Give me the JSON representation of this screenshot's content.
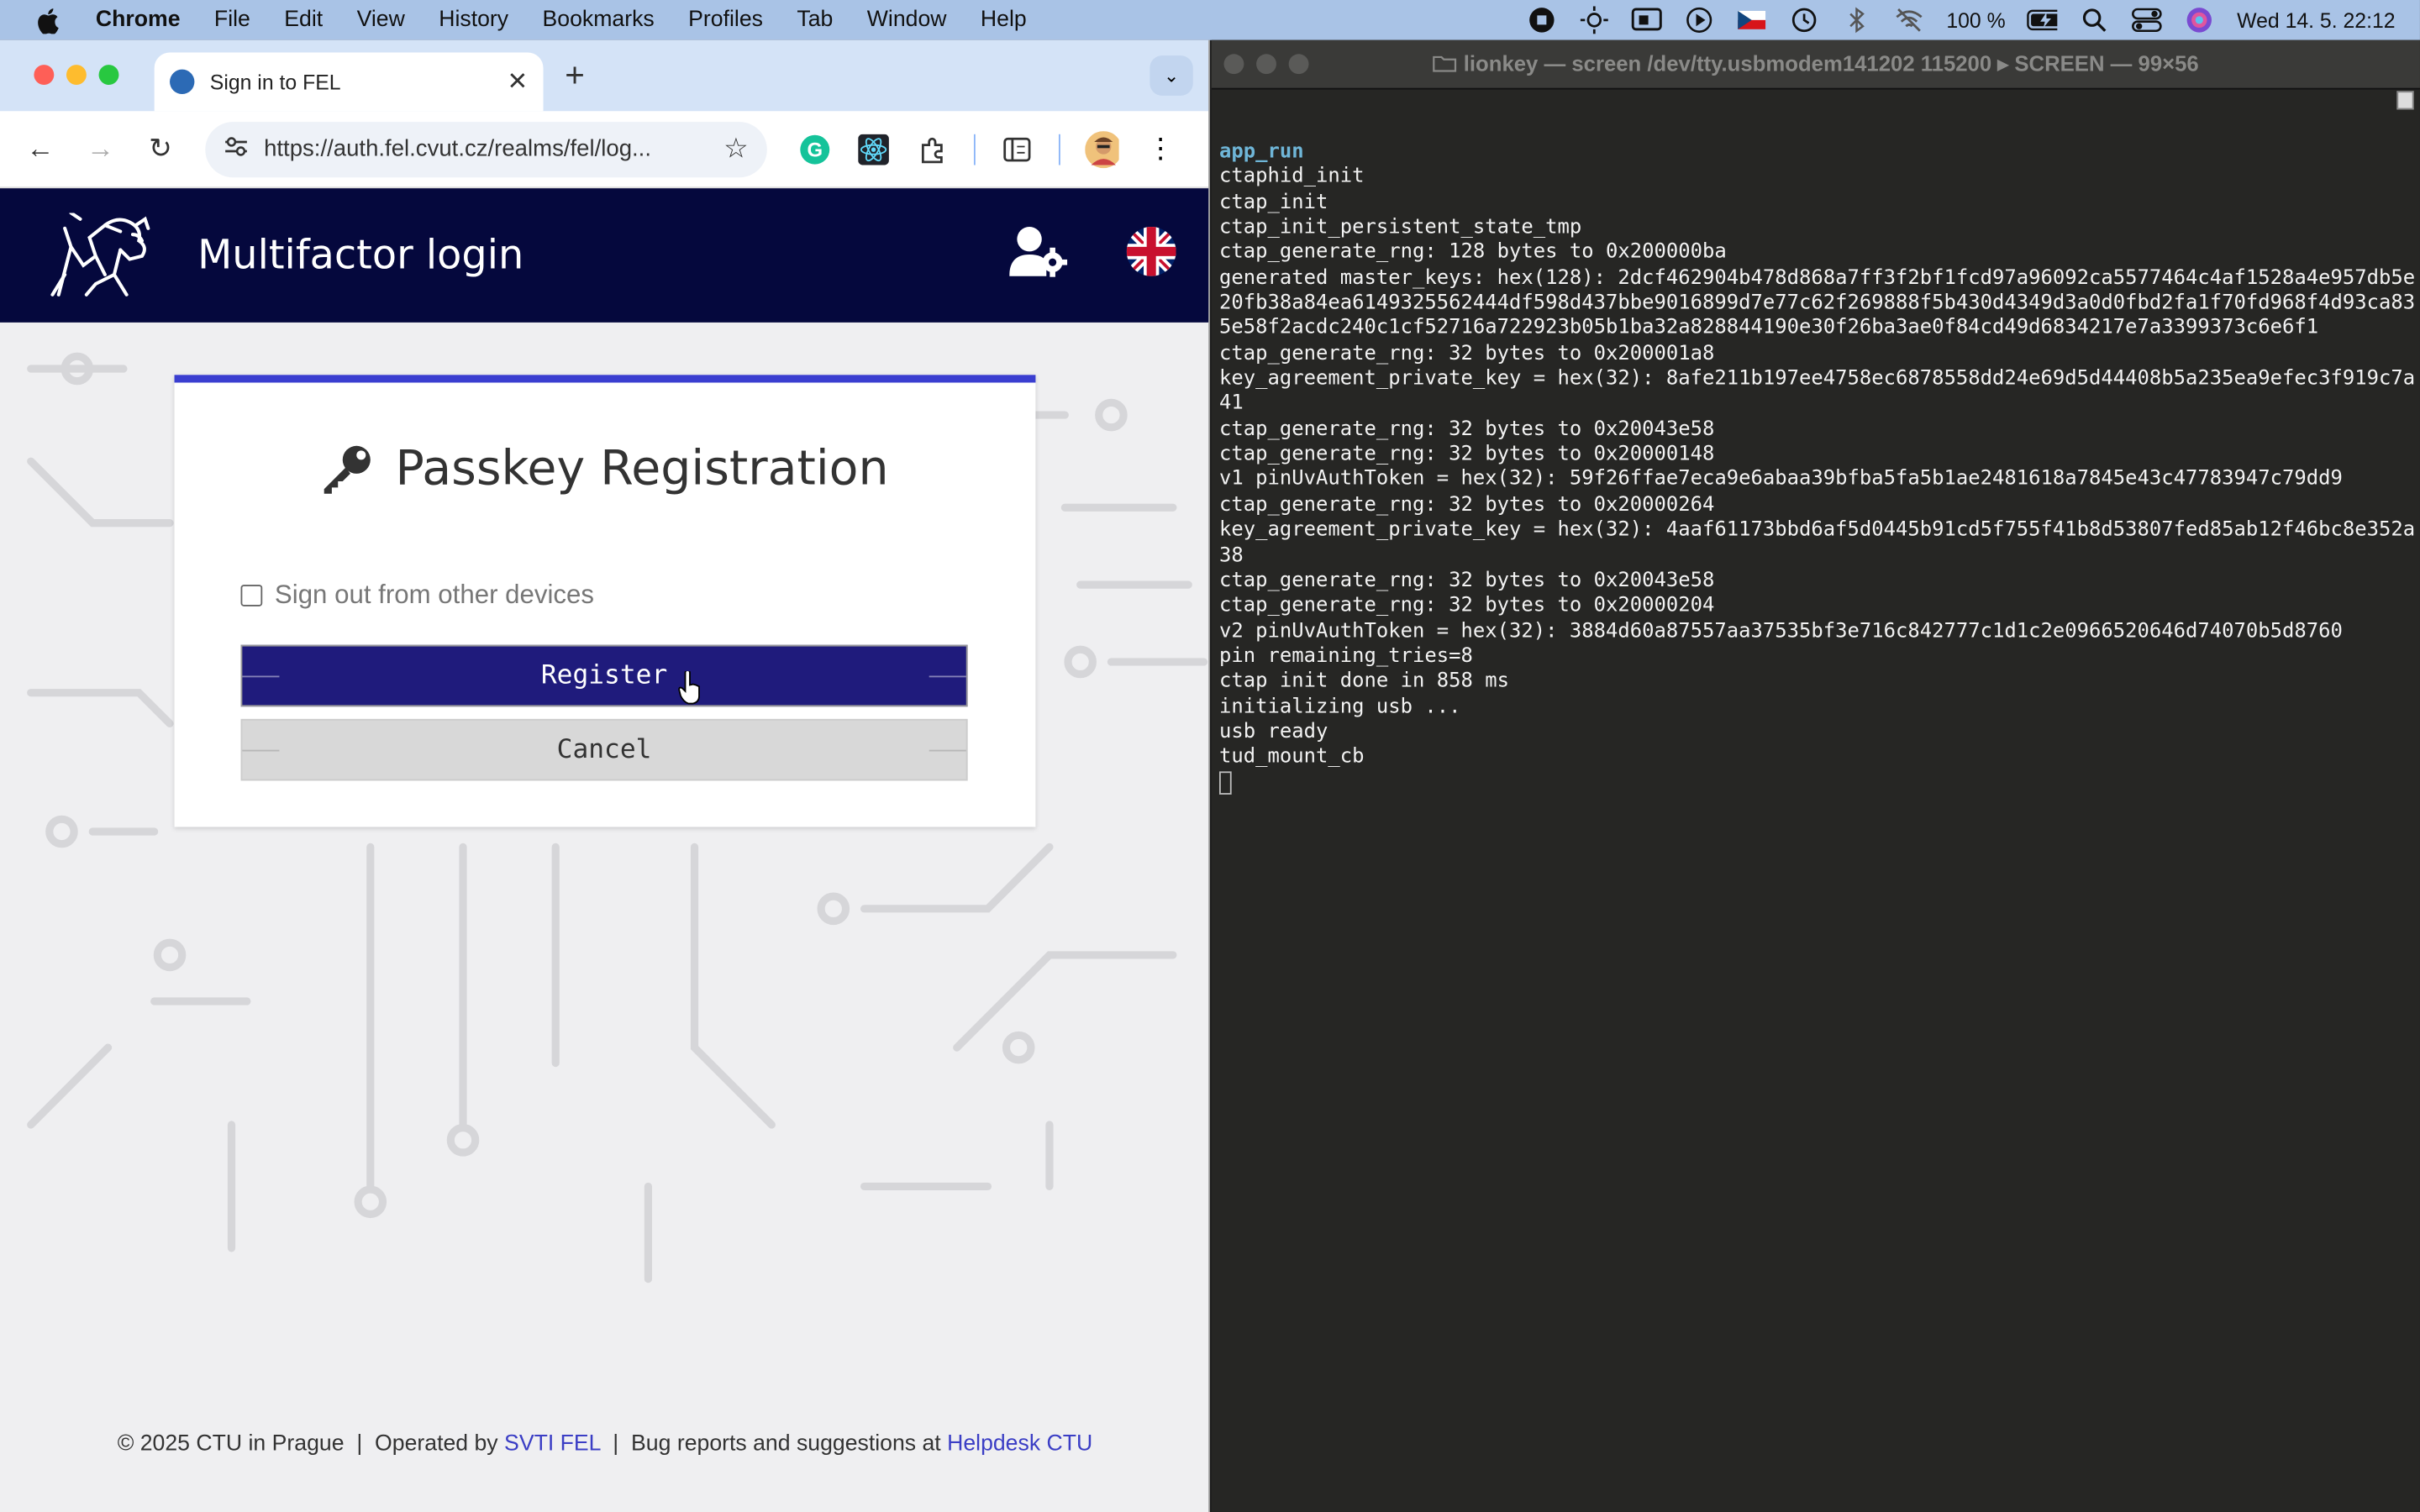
{
  "menubar": {
    "app_name": "Chrome",
    "items": [
      "File",
      "Edit",
      "View",
      "History",
      "Bookmarks",
      "Profiles",
      "Tab",
      "Window",
      "Help"
    ],
    "battery": "100 %",
    "datetime": "Wed 14. 5.  22:12"
  },
  "browser": {
    "tab_title": "Sign in to FEL",
    "url": "https://auth.fel.cvut.cz/realms/fel/log..."
  },
  "page": {
    "header_title": "Multifactor login",
    "card_title": "Passkey Registration",
    "checkbox_label": "Sign out from other devices",
    "register_label": "Register",
    "cancel_label": "Cancel",
    "footer": {
      "copyright": "© 2025 CTU in Prague",
      "operated_by": "Operated by",
      "operator": "SVTI FEL",
      "bug_reports": "Bug reports and suggestions at",
      "helpdesk": "Helpdesk CTU"
    }
  },
  "terminal": {
    "title": "lionkey — screen /dev/tty.usbmodem141202 115200 ▸ SCREEN — 99×56",
    "first_line": "app_run",
    "lines": [
      "ctaphid_init",
      "ctap_init",
      "ctap_init_persistent_state_tmp",
      "ctap_generate_rng: 128 bytes to 0x200000ba",
      "generated master_keys: hex(128): 2dcf462904b478d868a7ff3f2bf1fcd97a96092ca5577464c4af1528a4e957db5e",
      "20fb38a84ea6149325562444df598d437bbe9016899d7e77c62f269888f5b430d4349d3a0d0fbd2fa1f70fd968f4d93ca83",
      "5e58f2acdc240c1cf52716a722923b05b1ba32a828844190e30f26ba3ae0f84cd49d6834217e7a3399373c6e6f1",
      "ctap_generate_rng: 32 bytes to 0x200001a8",
      "key_agreement_private_key = hex(32): 8afe211b197ee4758ec6878558dd24e69d5d44408b5a235ea9efec3f919c7a",
      "41",
      "ctap_generate_rng: 32 bytes to 0x20043e58",
      "ctap_generate_rng: 32 bytes to 0x20000148",
      "v1 pinUvAuthToken = hex(32): 59f26ffae7eca9e6abaa39bfba5fa5b1ae2481618a7845e43c47783947c79dd9",
      "ctap_generate_rng: 32 bytes to 0x20000264",
      "key_agreement_private_key = hex(32): 4aaf61173bbd6af5d0445b91cd5f755f41b8d53807fed85ab12f46bc8e352a",
      "38",
      "ctap_generate_rng: 32 bytes to 0x20043e58",
      "ctap_generate_rng: 32 bytes to 0x20000204",
      "v2 pinUvAuthToken = hex(32): 3884d60a87557aa37535bf3e716c842777c1d1c2e0966520646d74070b5d8760",
      "pin remaining_tries=8",
      "ctap init done in 858 ms",
      "initializing usb ...",
      "usb ready",
      "tud_mount_cb"
    ]
  }
}
